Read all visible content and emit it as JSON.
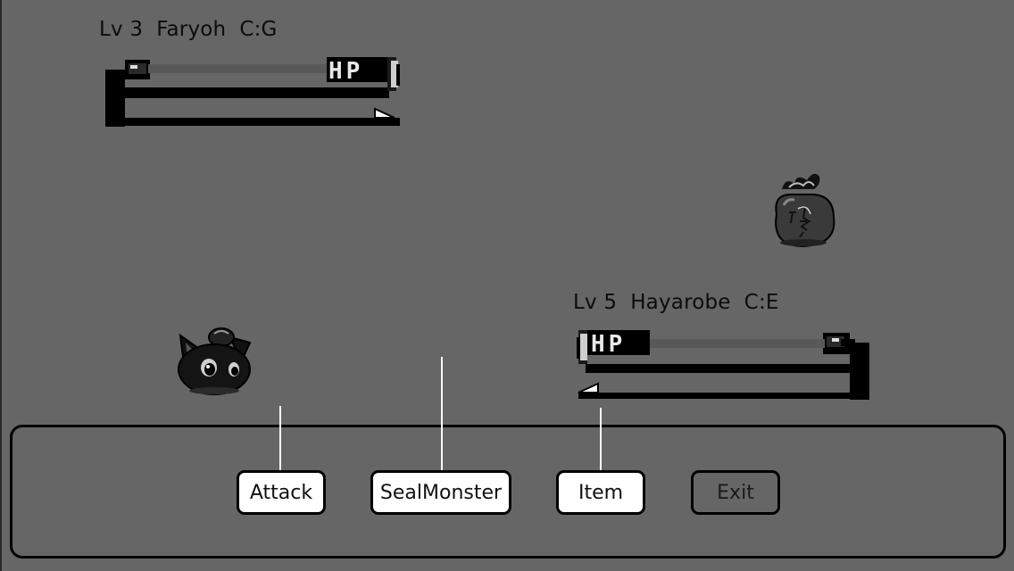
{
  "enemy": {
    "status": "Lv 3  Faryoh  C:G",
    "hp_tag": "HP",
    "hp_fraction": 1.0,
    "sprite": "money-bag-monster"
  },
  "player": {
    "status": "Lv 5  Hayarobe  C:E",
    "hp_tag": "HP",
    "hp_fraction": 1.0,
    "sprite": "black-cat-monster"
  },
  "menu": {
    "attack": "Attack",
    "seal": "SealMonster",
    "item": "Item",
    "exit": "Exit"
  },
  "colors": {
    "background": "#666666",
    "button_active": "#ffffff",
    "outline": "#000000"
  }
}
